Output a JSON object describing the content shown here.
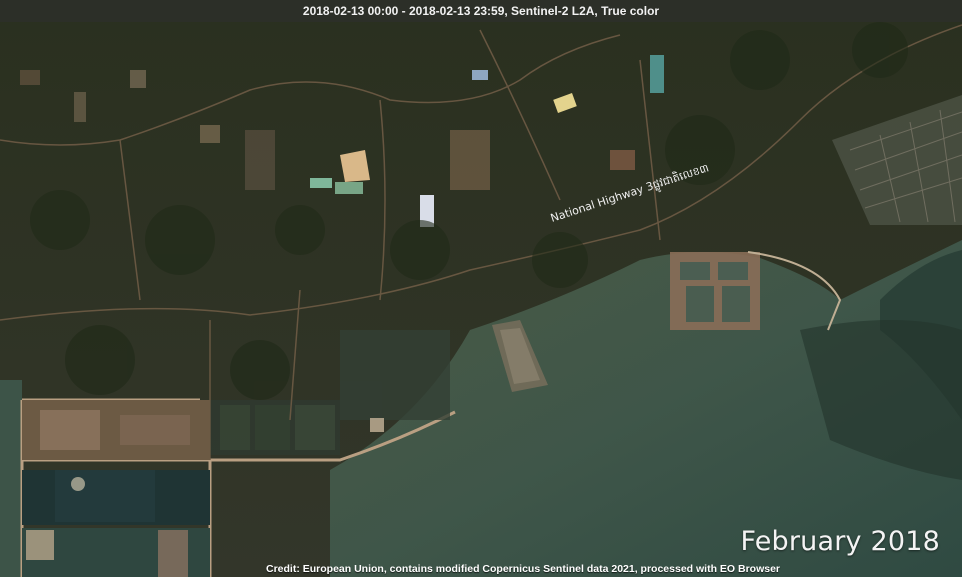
{
  "header": {
    "title": "2018-02-13 00:00 - 2018-02-13 23:59, Sentinel-2 L2A, True color"
  },
  "map": {
    "road_label": "National Highway 3ផ្លូវជាតិលេខ៣",
    "month_label": "February 2018",
    "credit": "Credit: European Union, contains modified Copernicus Sentinel data 2021, processed with EO Browser"
  },
  "colors": {
    "land": "#2c3222",
    "vegetation": "#25301c",
    "water": "#3f5a4c",
    "bare_ground": "#9a7a5a"
  }
}
